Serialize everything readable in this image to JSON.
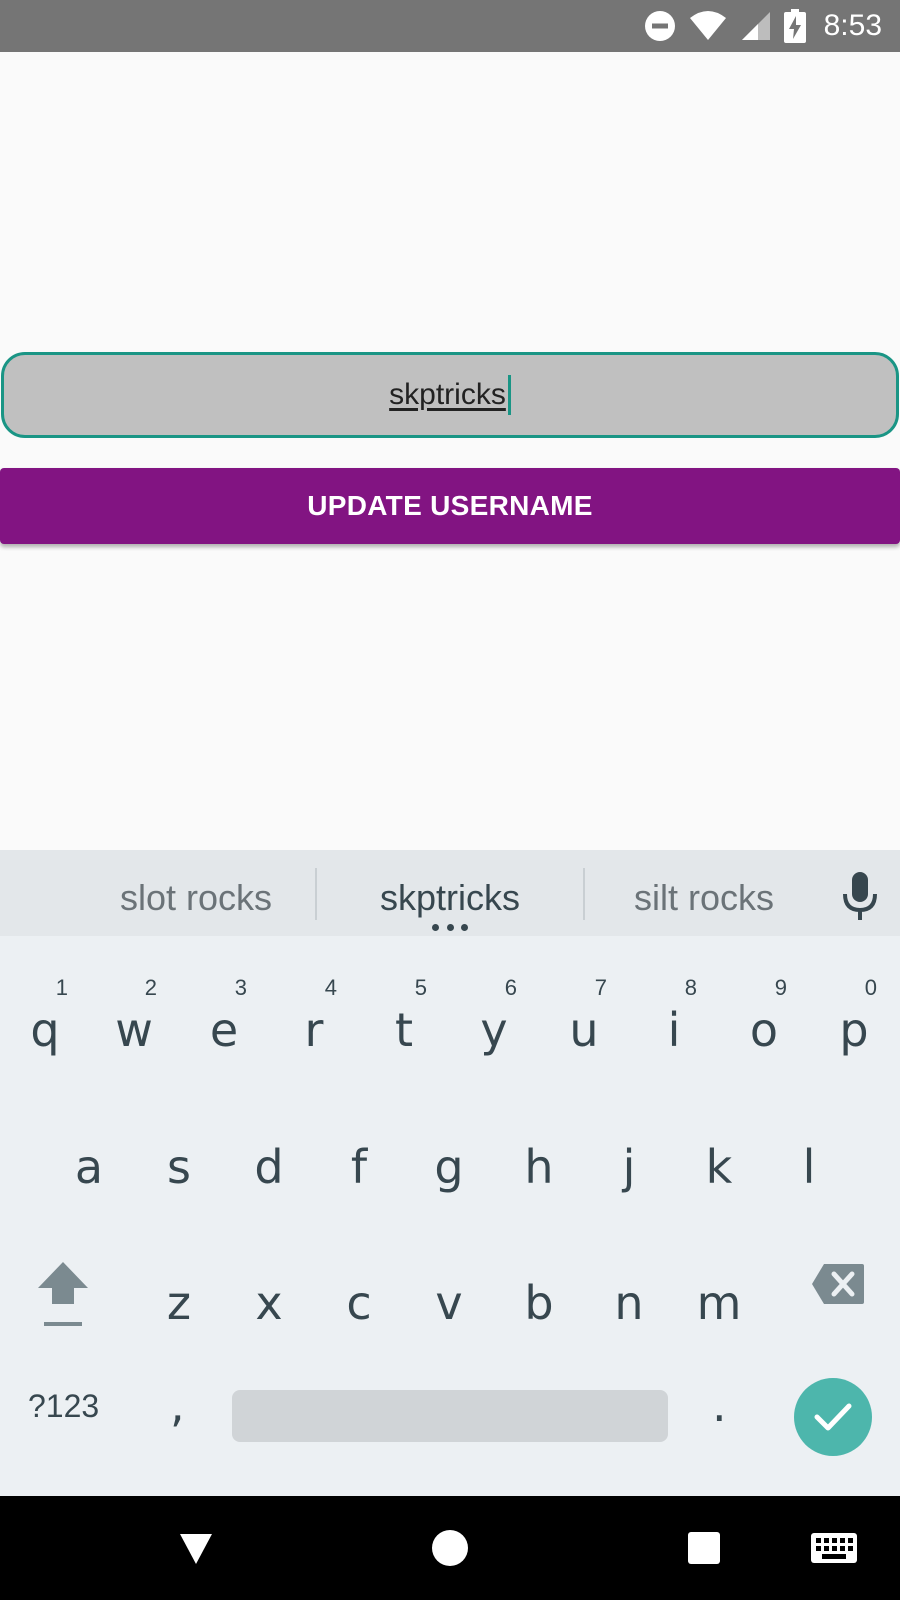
{
  "status_bar": {
    "time": "8:53",
    "icons": [
      "do-not-disturb-icon",
      "wifi-icon",
      "cellular-signal-icon",
      "battery-charging-icon"
    ]
  },
  "app": {
    "username_input": {
      "value": "skptricks"
    },
    "update_button": {
      "label": "UPDATE USERNAME"
    }
  },
  "keyboard": {
    "suggestions": [
      "slot rocks",
      "skptricks",
      "silt rocks"
    ],
    "row1": [
      {
        "key": "q",
        "hint": "1"
      },
      {
        "key": "w",
        "hint": "2"
      },
      {
        "key": "e",
        "hint": "3"
      },
      {
        "key": "r",
        "hint": "4"
      },
      {
        "key": "t",
        "hint": "5"
      },
      {
        "key": "y",
        "hint": "6"
      },
      {
        "key": "u",
        "hint": "7"
      },
      {
        "key": "i",
        "hint": "8"
      },
      {
        "key": "o",
        "hint": "9"
      },
      {
        "key": "p",
        "hint": "0"
      }
    ],
    "row2": [
      "a",
      "s",
      "d",
      "f",
      "g",
      "h",
      "j",
      "k",
      "l"
    ],
    "row3": [
      "z",
      "x",
      "c",
      "v",
      "b",
      "n",
      "m"
    ],
    "symbols_label": "?123",
    "comma": ",",
    "period": "."
  },
  "colors": {
    "accent_teal": "#1a9585",
    "button_purple": "#821482",
    "done_key": "#4db6ac",
    "status_bar": "#757575"
  },
  "nav_bar": {
    "icons": [
      "back-icon",
      "home-icon",
      "recents-icon",
      "keyboard-switch-icon"
    ]
  }
}
